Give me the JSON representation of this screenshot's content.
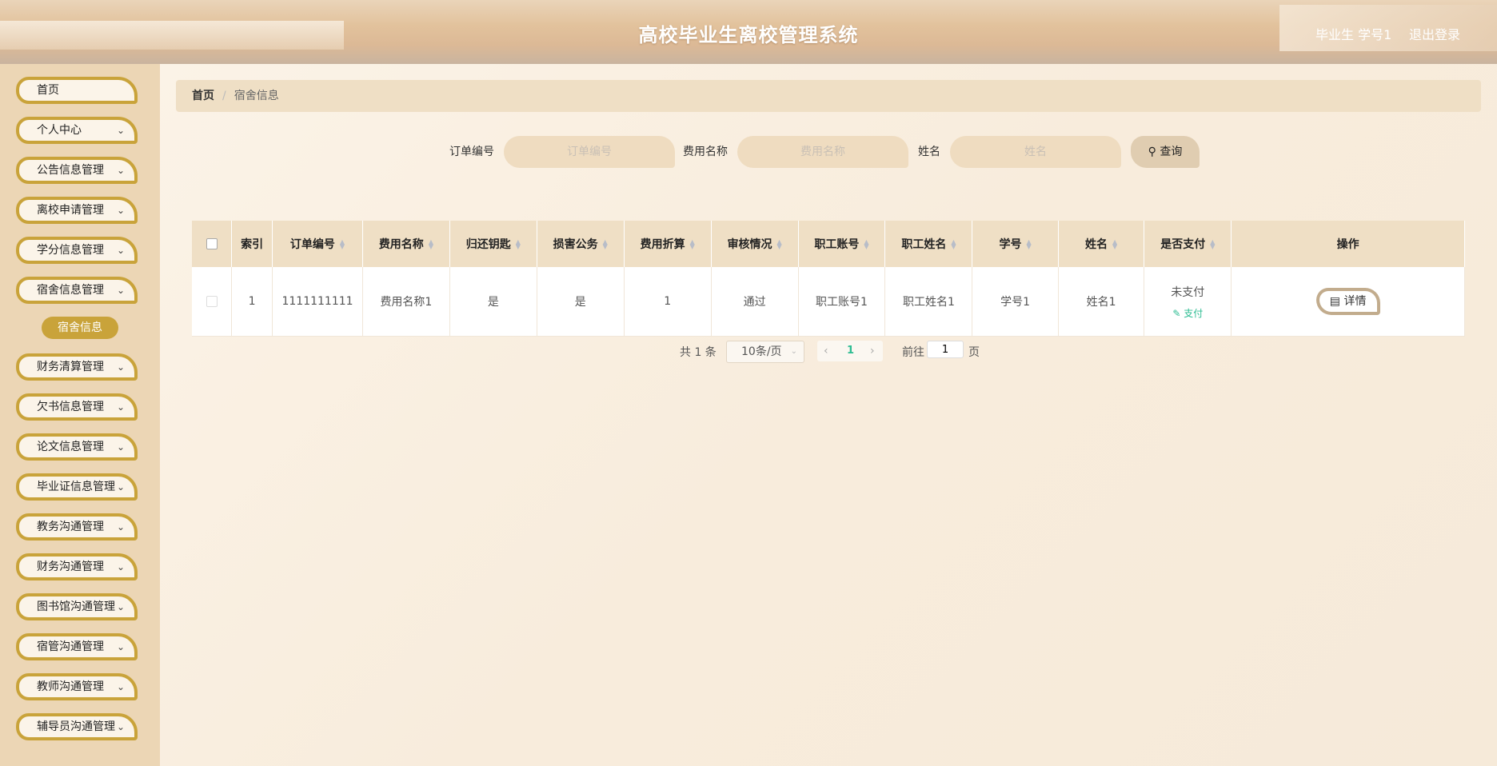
{
  "header": {
    "title": "高校毕业生离校管理系统",
    "user": "毕业生 学号1",
    "logout": "退出登录"
  },
  "sidebar": {
    "items": [
      {
        "label": "首页",
        "has_arrow": false
      },
      {
        "label": "个人中心",
        "has_arrow": true
      },
      {
        "label": "公告信息管理",
        "has_arrow": true
      },
      {
        "label": "离校申请管理",
        "has_arrow": true
      },
      {
        "label": "学分信息管理",
        "has_arrow": true
      },
      {
        "label": "宿舍信息管理",
        "has_arrow": true
      },
      {
        "label": "财务清算管理",
        "has_arrow": true
      },
      {
        "label": "欠书信息管理",
        "has_arrow": true
      },
      {
        "label": "论文信息管理",
        "has_arrow": true
      },
      {
        "label": "毕业证信息管理",
        "has_arrow": true
      },
      {
        "label": "教务沟通管理",
        "has_arrow": true
      },
      {
        "label": "财务沟通管理",
        "has_arrow": true
      },
      {
        "label": "图书馆沟通管理",
        "has_arrow": true
      },
      {
        "label": "宿管沟通管理",
        "has_arrow": true
      },
      {
        "label": "教师沟通管理",
        "has_arrow": true
      },
      {
        "label": "辅导员沟通管理",
        "has_arrow": true
      }
    ],
    "active_sub": "宿舍信息"
  },
  "breadcrumb": {
    "home": "首页",
    "separator": "/",
    "current": "宿舍信息"
  },
  "search": {
    "order_label": "订单编号",
    "order_placeholder": "订单编号",
    "fee_label": "费用名称",
    "fee_placeholder": "费用名称",
    "name_label": "姓名",
    "name_placeholder": "姓名",
    "button": "查询"
  },
  "table": {
    "columns": [
      "索引",
      "订单编号",
      "费用名称",
      "归还钥匙",
      "损害公务",
      "费用折算",
      "审核情况",
      "职工账号",
      "职工姓名",
      "学号",
      "姓名",
      "是否支付",
      "操作"
    ],
    "rows": [
      {
        "index": "1",
        "order_no": "1111111111",
        "fee_name": "费用名称1",
        "return_key": "是",
        "damage": "是",
        "fee_amount": "1",
        "review": "通过",
        "staff_account": "职工账号1",
        "staff_name": "职工姓名1",
        "student_no": "学号1",
        "name": "姓名1",
        "paid": "未支付",
        "pay_link": "支付",
        "detail": "详情"
      }
    ]
  },
  "pagination": {
    "total": "共 1 条",
    "page_size": "10条/页",
    "current_page": "1",
    "goto_label": "前往",
    "goto_value": "1",
    "page_suffix": "页"
  },
  "colors": {
    "accent_gold": "#c9a33a",
    "header_bg": "#efdfc5",
    "pay_green": "#2cbc92"
  }
}
